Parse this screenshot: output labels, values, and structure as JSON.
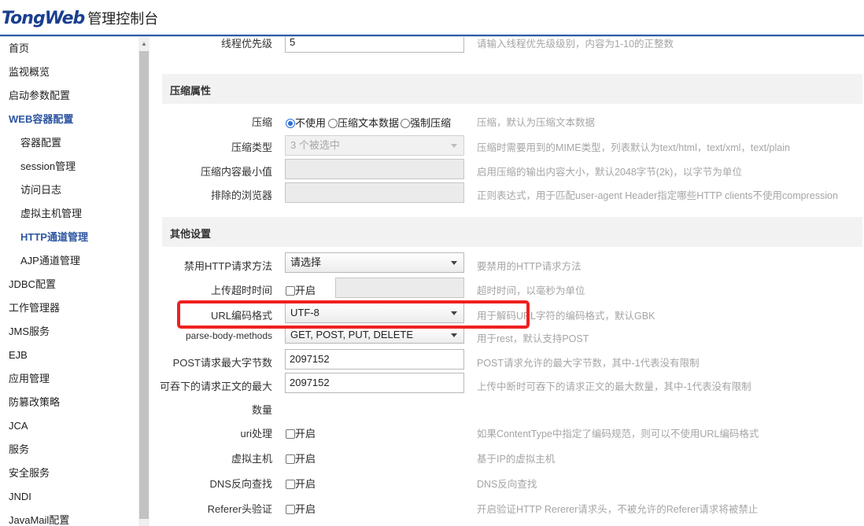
{
  "header": {
    "brand_a": "Tong",
    "brand_b": "Web",
    "console": "管理控制台"
  },
  "sidebar": {
    "items": [
      {
        "label": "首页"
      },
      {
        "label": "监视概览"
      },
      {
        "label": "启动参数配置"
      },
      {
        "label": "WEB容器配置"
      },
      {
        "label": "容器配置"
      },
      {
        "label": "session管理"
      },
      {
        "label": "访问日志"
      },
      {
        "label": "虚拟主机管理"
      },
      {
        "label": "HTTP通道管理"
      },
      {
        "label": "AJP通道管理"
      },
      {
        "label": "JDBC配置"
      },
      {
        "label": "工作管理器"
      },
      {
        "label": "JMS服务"
      },
      {
        "label": "EJB"
      },
      {
        "label": "应用管理"
      },
      {
        "label": "防篡改策略"
      },
      {
        "label": "JCA"
      },
      {
        "label": "服务"
      },
      {
        "label": "安全服务"
      },
      {
        "label": "JNDI"
      },
      {
        "label": "JavaMail配置"
      }
    ]
  },
  "form": {
    "thread_priority": {
      "label": "线程优先级",
      "value": "5",
      "hint": "请输入线程优先级级别，内容为1-10的正整数"
    },
    "compression_section": "压缩属性",
    "compression": {
      "label": "压缩",
      "options": [
        "不使用",
        "压缩文本数据",
        "强制压缩"
      ],
      "selected": "不使用",
      "hint": "压缩，默认为压缩文本数据"
    },
    "compression_type": {
      "label": "压缩类型",
      "value": "3 个被选中",
      "hint": "压缩时需要用到的MIME类型，列表默认为text/html，text/xml，text/plain"
    },
    "compression_min": {
      "label": "压缩内容最小值",
      "value": "",
      "hint": "启用压缩的输出内容大小，默认2048字节(2k)，以字节为单位"
    },
    "excluded_browsers": {
      "label": "排除的浏览器",
      "value": "",
      "hint": "正则表达式，用于匹配user-agent Header指定哪些HTTP clients不使用compression"
    },
    "other_section": "其他设置",
    "disabled_http_methods": {
      "label": "禁用HTTP请求方法",
      "value": "请选择",
      "hint": "要禁用的HTTP请求方法"
    },
    "upload_timeout": {
      "label": "上传超时时间",
      "checkbox_label": "开启",
      "value": "",
      "hint": "超时时间，以毫秒为单位"
    },
    "url_encoding": {
      "label": "URL编码格式",
      "value": "UTF-8",
      "hint": "用于解码URL字符的编码格式，默认GBK"
    },
    "parse_body_methods": {
      "label": "parse-body-methods",
      "value": "GET, POST, PUT, DELETE",
      "hint": "用于rest，默认支持POST"
    },
    "post_max_size": {
      "label": "POST请求最大字节数",
      "value": "2097152",
      "hint": "POST请求允许的最大字节数，其中-1代表没有限制"
    },
    "max_swallow": {
      "label_line1": "可吞下的请求正文的最大",
      "label_line2": "数量",
      "value": "2097152",
      "hint": "上传中断时可吞下的请求正文的最大数量，其中-1代表没有限制"
    },
    "uri_processing": {
      "label": "uri处理",
      "checkbox_label": "开启",
      "hint": "如果ContentType中指定了编码规范，则可以不使用URL编码格式"
    },
    "virtual_host": {
      "label": "虚拟主机",
      "checkbox_label": "开启",
      "hint": "基于IP的虚拟主机"
    },
    "dns_lookup": {
      "label": "DNS反向查找",
      "checkbox_label": "开启",
      "hint": "DNS反向查找"
    },
    "referer_check": {
      "label": "Referer头验证",
      "checkbox_label": "开启",
      "hint": "开启验证HTTP Rererer请求头，不被允许的Referer请求将被禁止"
    }
  },
  "colors": {
    "accent": "#2d55a0",
    "highlight": "#f02020",
    "hint": "#a5a5a5"
  }
}
